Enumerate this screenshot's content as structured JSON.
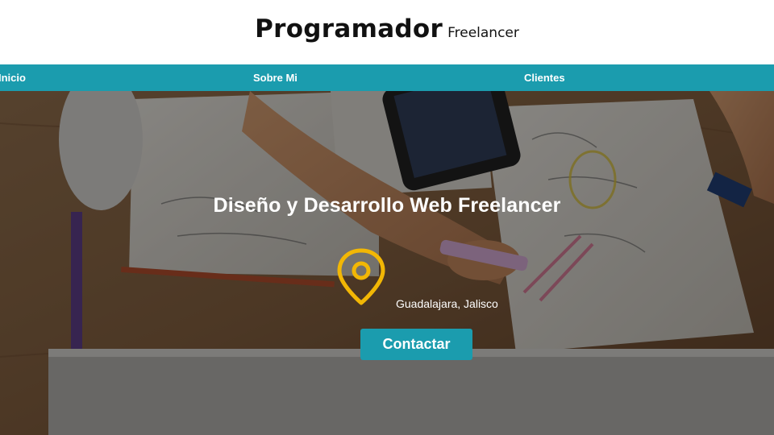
{
  "header": {
    "title": "Programador",
    "subtitle": "Freelancer"
  },
  "nav": {
    "items": [
      {
        "label": "Inicio"
      },
      {
        "label": "Sobre Mi"
      },
      {
        "label": "Clientes"
      }
    ]
  },
  "hero": {
    "title": "Diseño y Desarrollo Web Freelancer",
    "location_icon": "map-pin-icon",
    "location": "Guadalajara, Jalisco",
    "cta_label": "Contactar"
  },
  "colors": {
    "accent": "#1b9cae",
    "pin": "#f2b705",
    "header_bg": "#ffffff",
    "text_dark": "#111111"
  }
}
